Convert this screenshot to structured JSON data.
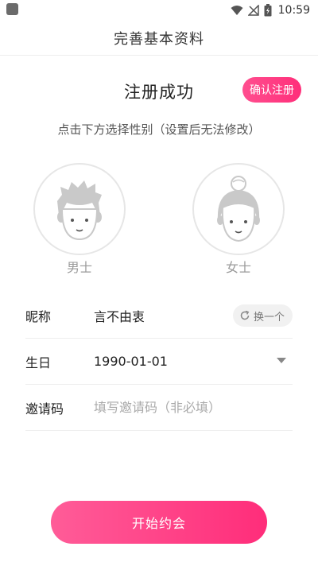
{
  "status_bar": {
    "time": "10:59",
    "icons": [
      "wifi-icon",
      "no-signal-icon",
      "battery-charging-icon"
    ]
  },
  "header": {
    "title": "完善基本资料"
  },
  "registration": {
    "success_text": "注册成功",
    "confirm_label": "确认注册",
    "hint": "点击下方选择性别（设置后无法修改）"
  },
  "gender": {
    "male_label": "男士",
    "female_label": "女士"
  },
  "form": {
    "nickname": {
      "label": "昵称",
      "value": "言不由衷",
      "change_label": "换一个"
    },
    "birthday": {
      "label": "生日",
      "value": "1990-01-01"
    },
    "invite": {
      "label": "邀请码",
      "placeholder": "填写邀请码（非必填）",
      "value": ""
    }
  },
  "actions": {
    "start_label": "开始约会"
  },
  "colors": {
    "accent": "#ff2f7a",
    "accent_light": "#ff5c98",
    "avatar_gray": "#c9c9c9"
  }
}
